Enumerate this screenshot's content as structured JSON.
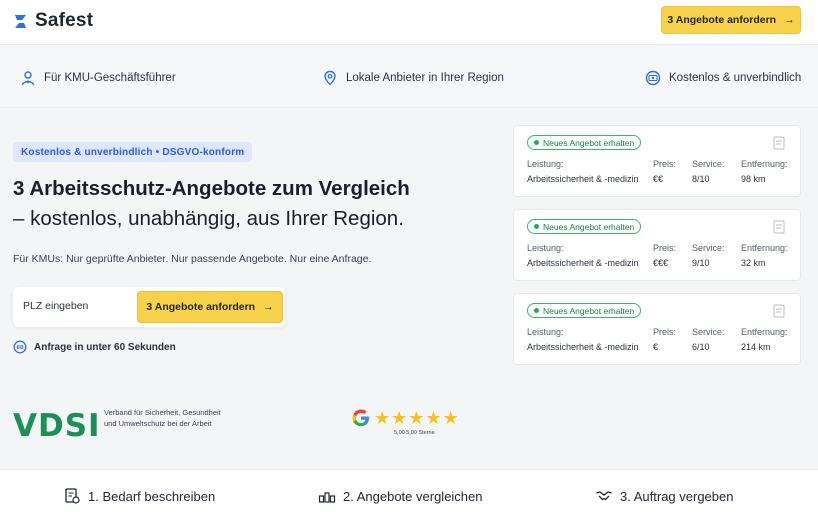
{
  "header": {
    "brand": "Safest",
    "cta_label": "3 Angebote anfordern"
  },
  "features": [
    {
      "icon": "user-tie-icon",
      "label": "Für KMU-Geschäftsführer"
    },
    {
      "icon": "location-pin-icon",
      "label": "Lokale Anbieter in Ihrer Region"
    },
    {
      "icon": "money-icon",
      "label": "Kostenlos & unverbindlich"
    }
  ],
  "hero": {
    "badge": "Kostenlos & unverbindlich • DSGVO-konform",
    "headline_line1": "3 Arbeitsschutz-Angebote zum Vergleich",
    "headline_line2": "– kostenlos, unabhängig, aus Ihrer Region.",
    "subtext": "Für KMUs: Nur geprüfte Anbieter. Nur passende Angebote. Nur eine Anfrage.",
    "plz_placeholder": "PLZ eingeben",
    "cta_label": "3 Angebote anfordern",
    "timer_text": "Anfrage in unter 60 Sekunden"
  },
  "offers": {
    "badge": "Neues Angebot erhalten",
    "labels": {
      "service_type": "Leistung:",
      "price": "Preis:",
      "rating": "Service:",
      "distance": "Entfernung:"
    },
    "items": [
      {
        "service_type": "Arbeitssicherheit & -medizin",
        "price": "€€",
        "rating": "8/10",
        "distance": "98 km"
      },
      {
        "service_type": "Arbeitssicherheit & -medizin",
        "price": "€€€",
        "rating": "9/10",
        "distance": "32 km"
      },
      {
        "service_type": "Arbeitssicherheit & -medizin",
        "price": "€",
        "rating": "6/10",
        "distance": "214 km"
      }
    ]
  },
  "trust": {
    "vdsi_logo": "VDSI",
    "vdsi_text": "Verband für Sicherheit, Gesundheit und Umweltschutz bei der Arbeit",
    "google_rating_text": "5,00 5,00 Sterne",
    "stars": 5
  },
  "steps": [
    {
      "icon": "document-icon",
      "label": "1. Bedarf beschreiben"
    },
    {
      "icon": "compare-icon",
      "label": "2. Angebote vergleichen"
    },
    {
      "icon": "handshake-icon",
      "label": "3. Auftrag vergeben"
    }
  ],
  "colors": {
    "accent_yellow": "#f8d24a",
    "badge_blue": "#2f5bd8",
    "vdsi_green": "#1a8f5a",
    "offer_green": "#26a95a",
    "icon_blue": "#2f6fe0"
  }
}
